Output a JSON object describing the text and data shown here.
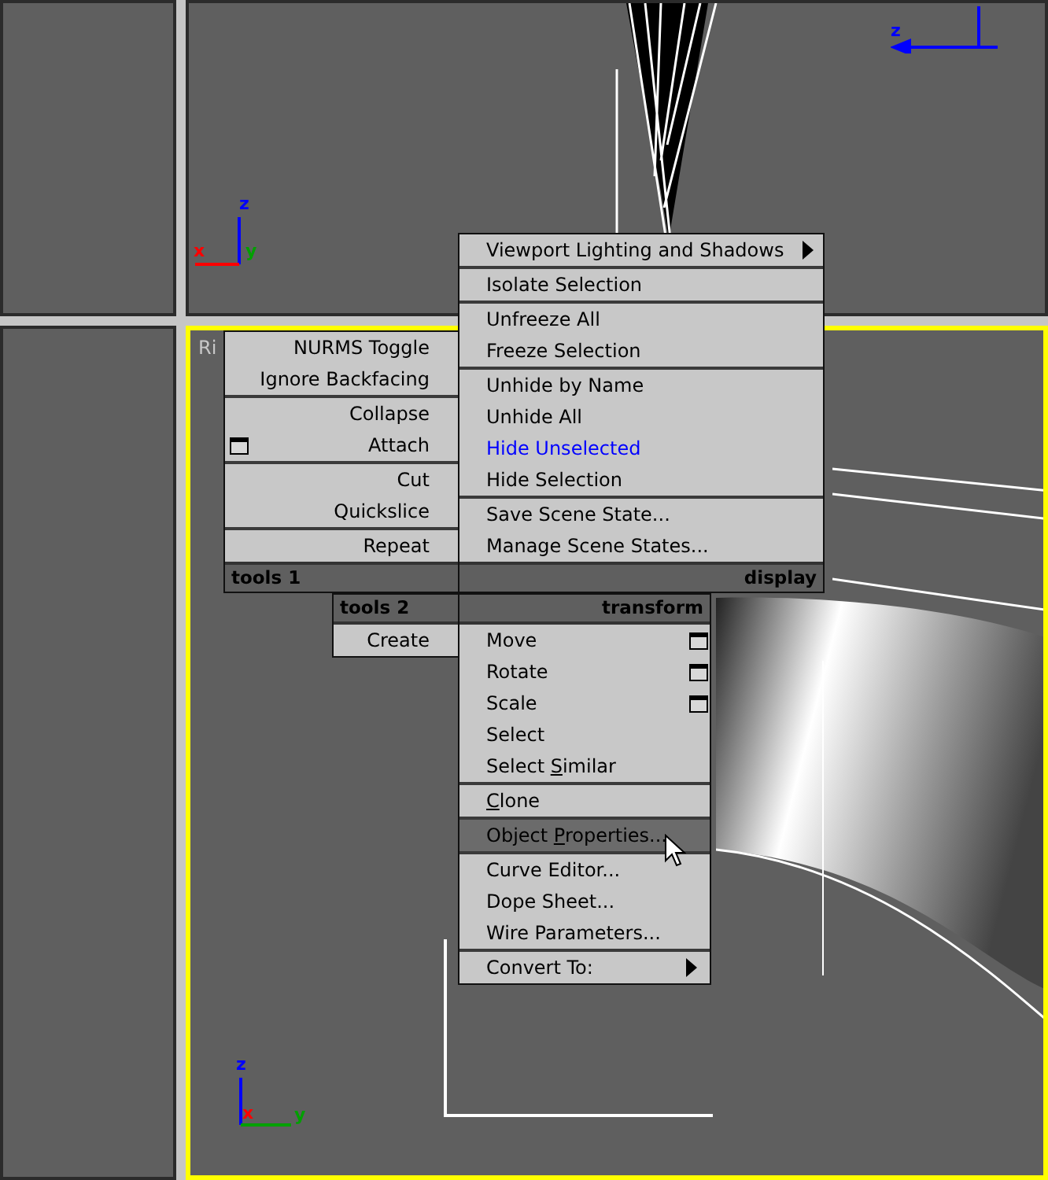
{
  "viewports": [
    {
      "active": false
    },
    {
      "active": false,
      "tripod": {
        "kind": "front",
        "axes": [
          {
            "label": "z",
            "color": "#0000ff"
          },
          {
            "label": "x",
            "color": "#ff0000"
          },
          {
            "label": "y",
            "color": "#00a000"
          }
        ]
      },
      "corner_axis": {
        "label": "z",
        "color": "#0000ff"
      }
    },
    {
      "active": false
    },
    {
      "active": true,
      "label": "Ri",
      "tripod": {
        "kind": "side",
        "axes": [
          {
            "label": "z",
            "color": "#0000ff"
          },
          {
            "label": "x",
            "color": "#ff0000"
          },
          {
            "label": "y",
            "color": "#00a000"
          }
        ]
      }
    }
  ],
  "quad_menu": {
    "quadrants": [
      {
        "title": "tools 1",
        "groups": [
          [
            {
              "label": "NURMS Toggle",
              "options": false,
              "submenu": false,
              "selected": false
            },
            {
              "label": "Ignore Backfacing",
              "options": false,
              "submenu": false,
              "selected": false
            }
          ],
          [
            {
              "label": "Collapse",
              "options": false,
              "submenu": false,
              "selected": false
            },
            {
              "label": "Attach",
              "options": true,
              "submenu": false,
              "selected": false
            }
          ],
          [
            {
              "label": "Cut",
              "options": false,
              "submenu": false,
              "selected": false
            },
            {
              "label": "Quickslice",
              "options": false,
              "submenu": false,
              "selected": false
            }
          ],
          [
            {
              "label": "Repeat",
              "options": false,
              "submenu": false,
              "selected": false
            }
          ]
        ]
      },
      {
        "title": "display",
        "groups": [
          [
            {
              "label": "Viewport Lighting and Shadows",
              "options": false,
              "submenu": true,
              "selected": false
            }
          ],
          [
            {
              "label": "Isolate Selection",
              "options": false,
              "submenu": false,
              "selected": false
            }
          ],
          [
            {
              "label": "Unfreeze All",
              "options": false,
              "submenu": false,
              "selected": false
            },
            {
              "label": "Freeze Selection",
              "options": false,
              "submenu": false,
              "selected": false
            }
          ],
          [
            {
              "label": "Unhide by Name",
              "options": false,
              "submenu": false,
              "selected": false
            },
            {
              "label": "Unhide All",
              "options": false,
              "submenu": false,
              "selected": false
            },
            {
              "label": "Hide Unselected",
              "options": false,
              "submenu": false,
              "selected": false,
              "color": "#0000ff"
            },
            {
              "label": "Hide Selection",
              "options": false,
              "submenu": false,
              "selected": false
            }
          ],
          [
            {
              "label": "Save Scene State...",
              "options": false,
              "submenu": false,
              "selected": false
            },
            {
              "label": "Manage Scene States...",
              "options": false,
              "submenu": false,
              "selected": false
            }
          ]
        ]
      },
      {
        "title": "tools 2",
        "groups": [
          [
            {
              "label": "Create",
              "options": false,
              "submenu": false,
              "selected": false
            }
          ]
        ]
      },
      {
        "title": "transform",
        "groups": [
          [
            {
              "label": "Move",
              "options": true,
              "submenu": false,
              "selected": false
            },
            {
              "label": "Rotate",
              "options": true,
              "submenu": false,
              "selected": false
            },
            {
              "label": "Scale",
              "options": true,
              "submenu": false,
              "selected": false
            },
            {
              "label": "Select",
              "options": false,
              "submenu": false,
              "selected": false
            },
            {
              "label_parts": {
                "before": "Select ",
                "key": "S",
                "after": "imilar"
              },
              "options": false,
              "submenu": false,
              "selected": false
            }
          ],
          [
            {
              "label_parts": {
                "key": "C",
                "after": "lone"
              },
              "options": false,
              "submenu": false,
              "selected": false
            }
          ],
          [
            {
              "label_parts": {
                "before": "Object ",
                "key": "P",
                "after": "roperties..."
              },
              "options": false,
              "submenu": false,
              "selected": true
            }
          ],
          [
            {
              "label": "Curve Editor...",
              "options": false,
              "submenu": false,
              "selected": false
            },
            {
              "label": "Dope Sheet...",
              "options": false,
              "submenu": false,
              "selected": false
            },
            {
              "label": "Wire Parameters...",
              "options": false,
              "submenu": false,
              "selected": false
            }
          ],
          [
            {
              "label": "Convert To:",
              "options": false,
              "submenu": true,
              "selected": false
            }
          ]
        ]
      }
    ]
  }
}
